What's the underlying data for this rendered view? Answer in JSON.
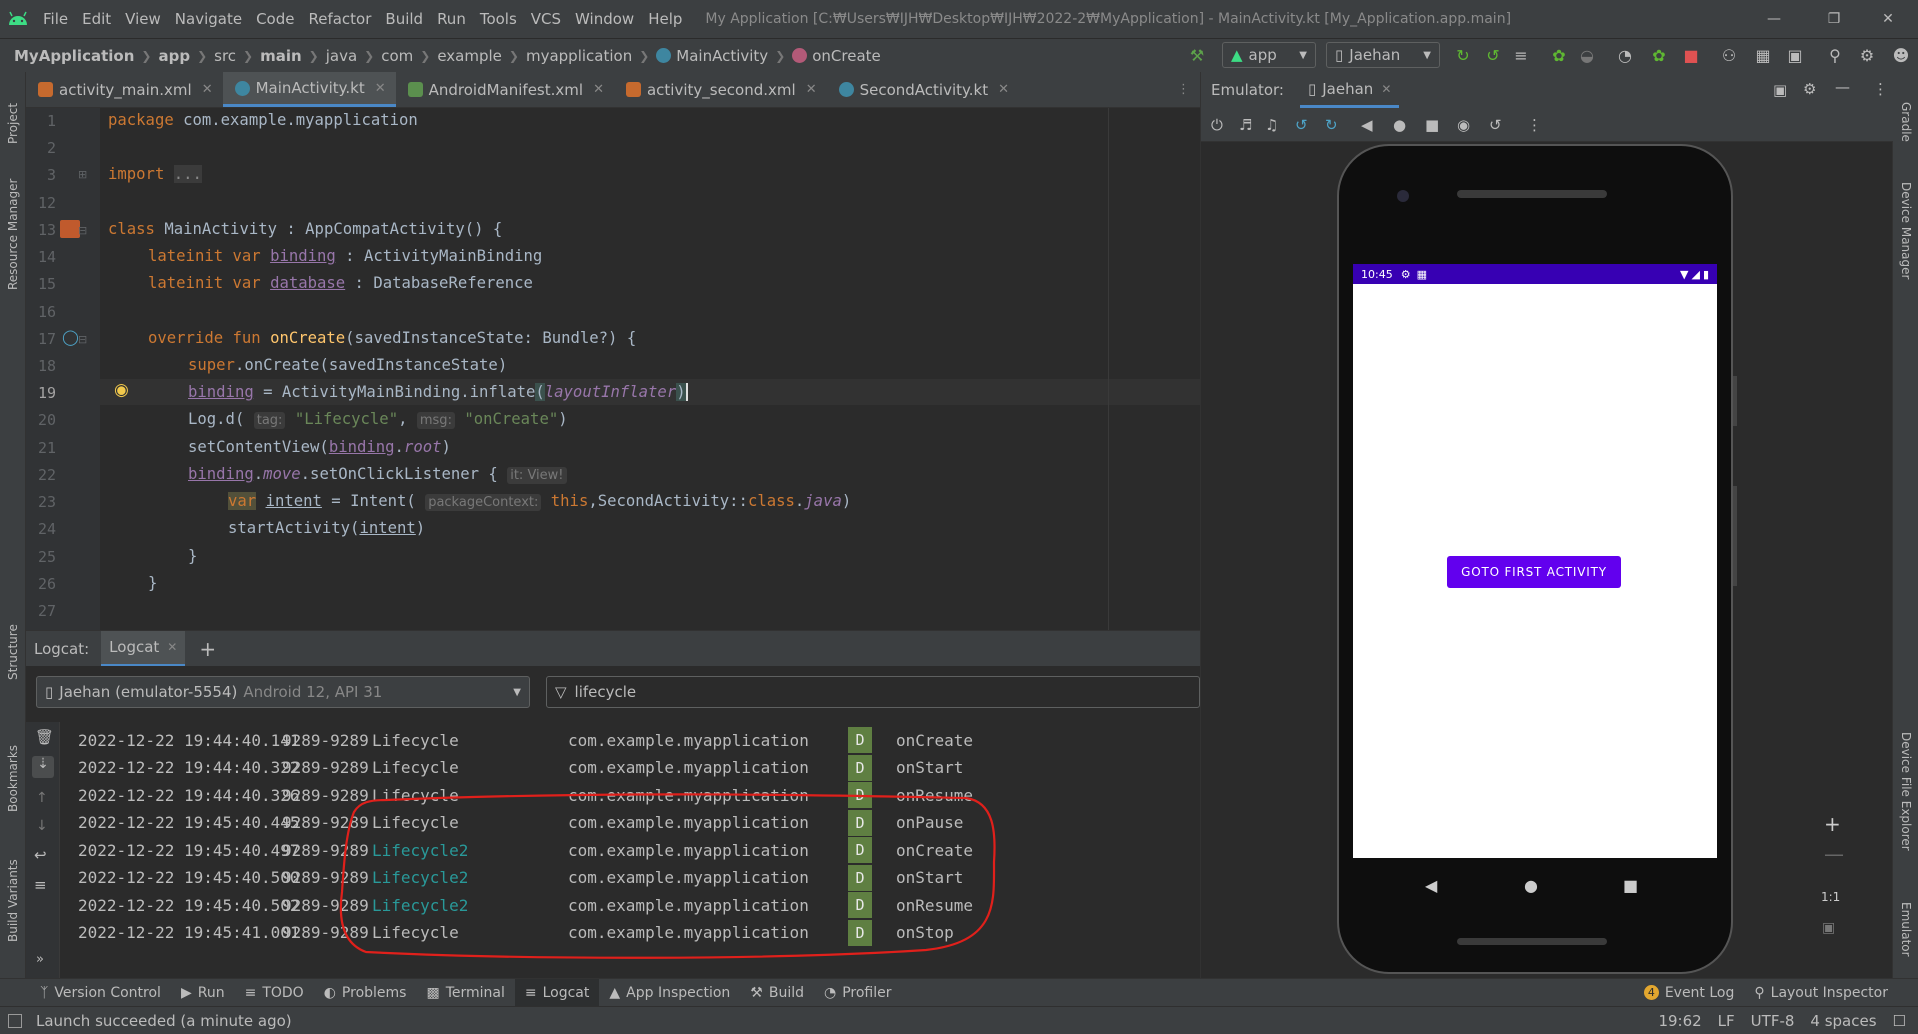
{
  "window": {
    "menu": [
      "File",
      "Edit",
      "View",
      "Navigate",
      "Code",
      "Refactor",
      "Build",
      "Run",
      "Tools",
      "VCS",
      "Window",
      "Help"
    ],
    "title": "My Application [C:₩Users₩IJH₩Desktop₩IJH₩2022-2₩MyApplication] - MainActivity.kt [My_Application.app.main]"
  },
  "breadcrumb": {
    "project": "MyApplication",
    "items": [
      "app",
      "src",
      "main",
      "java",
      "com",
      "example",
      "myapplication",
      "MainActivity",
      "onCreate"
    ]
  },
  "toolbar": {
    "run_config": "app",
    "device": "Jaehan"
  },
  "left_stripe": [
    "Project",
    "Resource Manager",
    "Structure",
    "Bookmarks",
    "Build Variants"
  ],
  "right_stripe": [
    "Gradle",
    "Device Manager",
    "Device File Explorer",
    "Emulator"
  ],
  "editor_tabs": [
    {
      "label": "activity_main.xml",
      "type": "xml"
    },
    {
      "label": "MainActivity.kt",
      "type": "kt",
      "active": true
    },
    {
      "label": "AndroidManifest.xml",
      "type": "manifest"
    },
    {
      "label": "activity_second.xml",
      "type": "xml"
    },
    {
      "label": "SecondActivity.kt",
      "type": "kt"
    }
  ],
  "editor": {
    "line_numbers": [
      "1",
      "2",
      "3",
      "12",
      "13",
      "14",
      "15",
      "16",
      "17",
      "18",
      "19",
      "20",
      "21",
      "22",
      "23",
      "24",
      "25",
      "26",
      "27"
    ],
    "current_line": "19",
    "hints": {
      "tag": "tag:",
      "msg": "msg:",
      "it": "it: View!",
      "packageContext": "packageContext:"
    }
  },
  "logcat": {
    "panel_label": "Logcat:",
    "tab_label": "Logcat",
    "device_label": "Jaehan (emulator-5554)",
    "device_api": "Android 12, API 31",
    "filter": "lifecycle",
    "rows": [
      {
        "ts": "2022-12-22 19:44:40.141",
        "pid": "9289-9289",
        "tag": "Lifecycle",
        "pkg": "com.example.myapplication",
        "level": "D",
        "msg": "onCreate"
      },
      {
        "ts": "2022-12-22 19:44:40.322",
        "pid": "9289-9289",
        "tag": "Lifecycle",
        "pkg": "com.example.myapplication",
        "level": "D",
        "msg": "onStart"
      },
      {
        "ts": "2022-12-22 19:44:40.326",
        "pid": "9289-9289",
        "tag": "Lifecycle",
        "pkg": "com.example.myapplication",
        "level": "D",
        "msg": "onResume"
      },
      {
        "ts": "2022-12-22 19:45:40.445",
        "pid": "9289-9289",
        "tag": "Lifecycle",
        "pkg": "com.example.myapplication",
        "level": "D",
        "msg": "onPause"
      },
      {
        "ts": "2022-12-22 19:45:40.497",
        "pid": "9289-9289",
        "tag": "Lifecycle2",
        "pkg": "com.example.myapplication",
        "level": "D",
        "msg": "onCreate"
      },
      {
        "ts": "2022-12-22 19:45:40.500",
        "pid": "9289-9289",
        "tag": "Lifecycle2",
        "pkg": "com.example.myapplication",
        "level": "D",
        "msg": "onStart"
      },
      {
        "ts": "2022-12-22 19:45:40.502",
        "pid": "9289-9289",
        "tag": "Lifecycle2",
        "pkg": "com.example.myapplication",
        "level": "D",
        "msg": "onResume"
      },
      {
        "ts": "2022-12-22 19:45:41.001",
        "pid": "9289-9289",
        "tag": "Lifecycle",
        "pkg": "com.example.myapplication",
        "level": "D",
        "msg": "onStop"
      }
    ],
    "colors": {
      "tag_default": "#bbbbbb",
      "tag_second": "#299999",
      "level_bg": "#5f7f42",
      "annotation": "#e0201b"
    }
  },
  "emulator": {
    "label": "Emulator:",
    "tab": "Jaehan",
    "phone": {
      "time": "10:45",
      "button_label": "GOTO FIRST ACTIVITY",
      "status_bar_color": "#3700b3",
      "button_color": "#6200ee"
    },
    "zoom_label": "1:1"
  },
  "bottom_tools": [
    "Version Control",
    "Run",
    "TODO",
    "Problems",
    "Terminal",
    "Logcat",
    "App Inspection",
    "Build",
    "Profiler"
  ],
  "bottom_right": {
    "event_log": "Event Log",
    "event_count": "4",
    "layout_inspector": "Layout Inspector"
  },
  "status": {
    "message": "Launch succeeded (a minute ago)",
    "position": "19:62",
    "line_sep": "LF",
    "encoding": "UTF-8",
    "indent": "4 spaces"
  }
}
